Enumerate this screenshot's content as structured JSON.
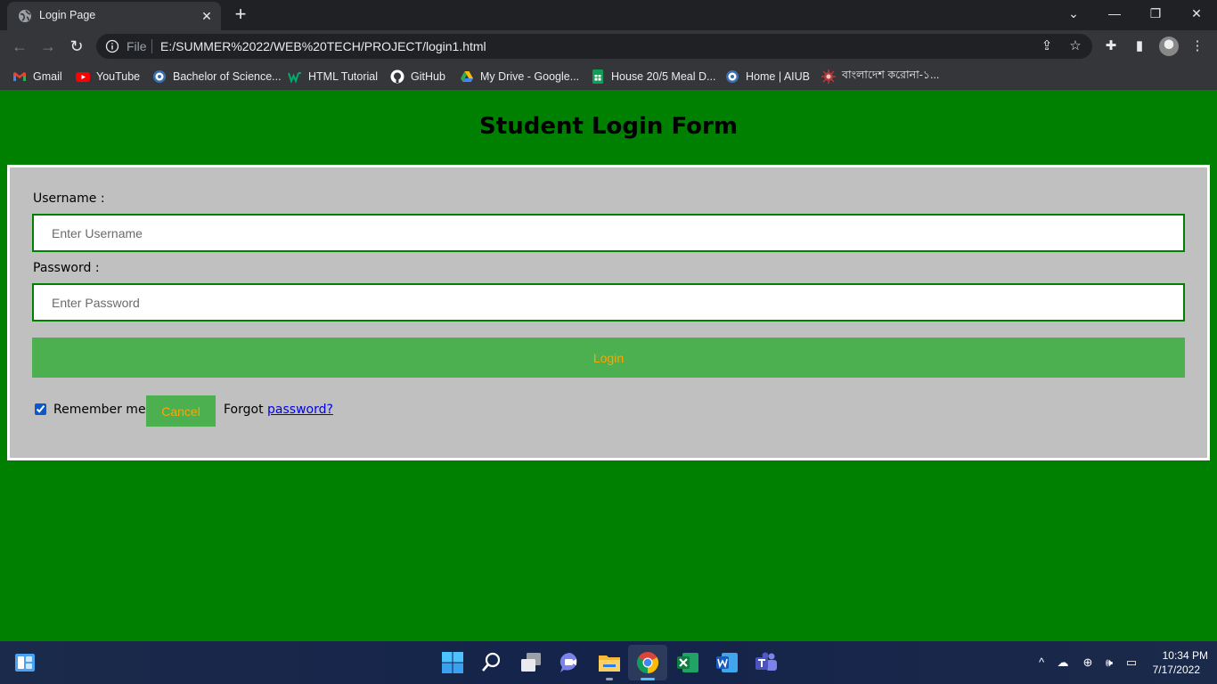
{
  "browser": {
    "tab": {
      "title": "Login Page",
      "close_glyph": "✕"
    },
    "new_tab_glyph": "+",
    "window_controls": {
      "minimize": "—",
      "restore": "❐",
      "close": "✕"
    },
    "nav": {
      "back": "←",
      "forward": "→",
      "reload": "↻"
    },
    "address": {
      "scheme_label": "File",
      "url": "E:/SUMMER%2022/WEB%20TECH/PROJECT/login1.html"
    },
    "toolbar_icons": {
      "share": "⇪",
      "bookmark_star": "☆",
      "extensions": "✚",
      "side_panel": "▮",
      "menu": "⋮"
    },
    "bookmarks": [
      {
        "label": "Gmail",
        "icon": "gmail-icon"
      },
      {
        "label": "YouTube",
        "icon": "youtube-icon"
      },
      {
        "label": "Bachelor of Science...",
        "icon": "aiub-icon"
      },
      {
        "label": "HTML Tutorial",
        "icon": "w3schools-icon"
      },
      {
        "label": "GitHub",
        "icon": "github-icon"
      },
      {
        "label": "My Drive - Google...",
        "icon": "google-drive-icon"
      },
      {
        "label": "House 20/5 Meal D...",
        "icon": "google-sheets-icon"
      },
      {
        "label": "Home | AIUB",
        "icon": "aiub-icon"
      },
      {
        "label": "বাংলাদেশ করোনা-১...",
        "icon": "corona-icon"
      }
    ]
  },
  "page": {
    "title": "Student Login Form",
    "form": {
      "username_label": "Username :",
      "username_placeholder": "Enter Username",
      "password_label": "Password :",
      "password_placeholder": "Enter Password",
      "login_button": "Login",
      "remember_label": "Remember me",
      "remember_checked": true,
      "cancel_button": "Cancel",
      "forgot_text": "Forgot",
      "forgot_link": "password?"
    },
    "colors": {
      "background": "#008000",
      "form_bg": "#c0c0c0",
      "button_bg": "#4caf50",
      "button_text": "#ffa500",
      "field_border": "#008000",
      "link": "#0000ee"
    }
  },
  "taskbar": {
    "apps": [
      "widgets-icon",
      "start-icon",
      "search-icon",
      "task-view-icon",
      "chat-icon",
      "file-explorer-icon",
      "chrome-icon",
      "excel-icon",
      "word-icon",
      "teams-icon"
    ],
    "tray": {
      "chevron": "^",
      "onedrive": "☁",
      "network": "⊕",
      "volume": "🕪",
      "battery": "▭"
    },
    "clock": {
      "time": "10:34 PM",
      "date": "7/17/2022"
    }
  }
}
